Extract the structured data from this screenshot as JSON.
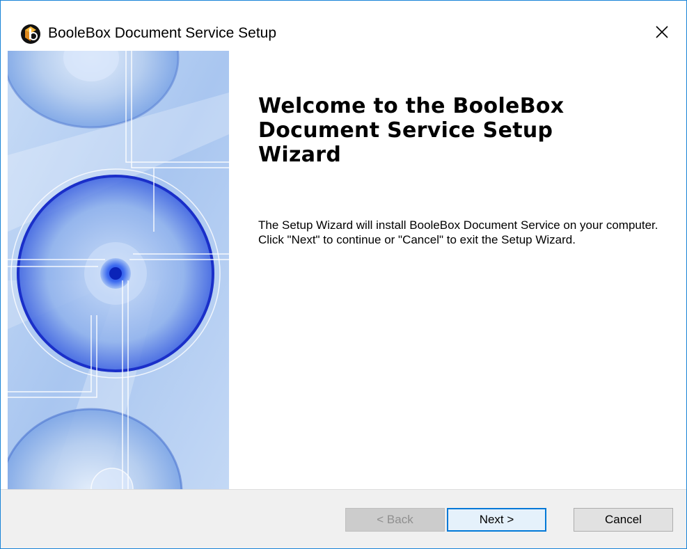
{
  "window": {
    "title": "BooleBox Document Service Setup",
    "close_icon": "close-icon",
    "app_icon": "boolebox-logo-icon"
  },
  "content": {
    "heading": "Welcome to the BooleBox Document Service Setup Wizard",
    "description": "The Setup Wizard will install BooleBox Document Service on your computer.  Click \"Next\" to continue or \"Cancel\" to exit the Setup Wizard."
  },
  "buttons": {
    "back": "< Back",
    "next": "Next >",
    "cancel": "Cancel"
  },
  "colors": {
    "accent": "#0078d7",
    "window_border": "#1883d7",
    "footer_bg": "#f0f0f0"
  }
}
